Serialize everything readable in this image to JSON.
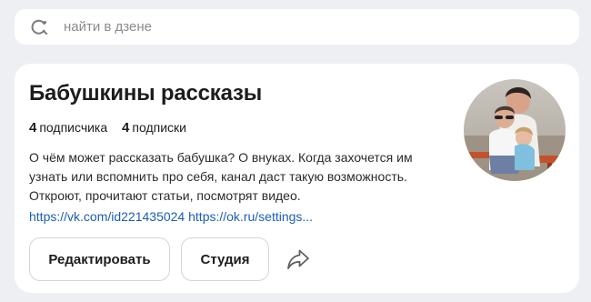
{
  "search": {
    "placeholder": "найти в дзене",
    "value": ""
  },
  "channel": {
    "title": "Бабушкины рассказы",
    "stats": [
      {
        "value": "4",
        "label": "подписчика"
      },
      {
        "value": "4",
        "label": "подписки"
      }
    ],
    "description": "О чём может рассказать бабушка? О внуках. Когда захочется им узнать или вспомнить про себя, канал даст такую возможность. Откроют, прочитают статьи, посмотрят видео.",
    "links": [
      "https://vk.com/id221435024",
      "https://ok.ru/settings..."
    ]
  },
  "actions": {
    "edit_label": "Редактировать",
    "studio_label": "Студия"
  },
  "icons": {
    "search": "search-icon",
    "share": "share-icon",
    "avatar": "avatar-photo"
  },
  "colors": {
    "background": "#eeeff2",
    "link": "#1a5fb4",
    "text": "#1c1c1e",
    "muted": "#8a8b8f"
  }
}
